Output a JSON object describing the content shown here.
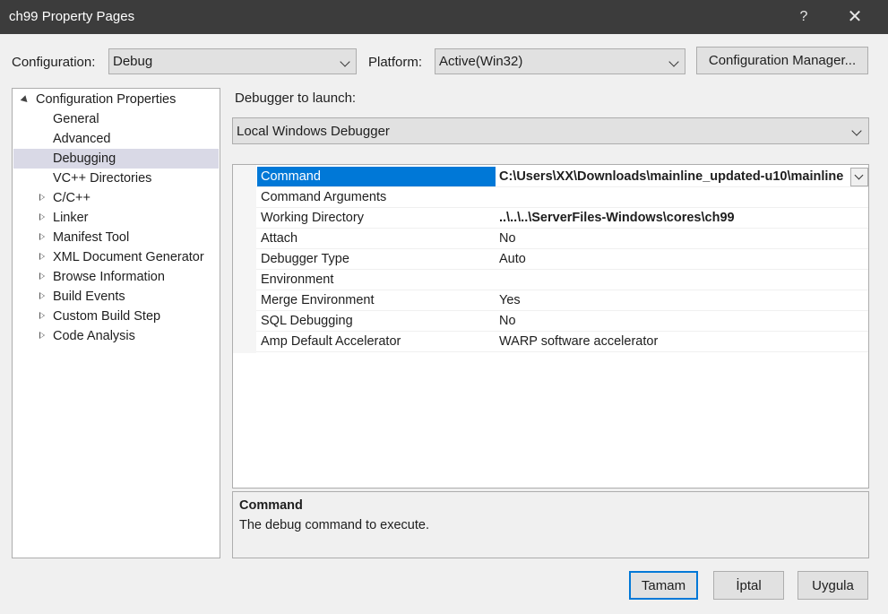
{
  "window": {
    "title": "ch99 Property Pages",
    "help_label": "?",
    "close_label": "✕"
  },
  "header": {
    "configuration_label": "Configuration:",
    "configuration_value": "Debug",
    "platform_label": "Platform:",
    "platform_value": "Active(Win32)",
    "config_manager_label": "Configuration Manager..."
  },
  "tree": {
    "root": "Configuration Properties",
    "items": [
      {
        "label": "General"
      },
      {
        "label": "Advanced"
      },
      {
        "label": "Debugging",
        "selected": true
      },
      {
        "label": "VC++ Directories"
      },
      {
        "label": "C/C++",
        "expandable": true
      },
      {
        "label": "Linker",
        "expandable": true
      },
      {
        "label": "Manifest Tool",
        "expandable": true
      },
      {
        "label": "XML Document Generator",
        "expandable": true
      },
      {
        "label": "Browse Information",
        "expandable": true
      },
      {
        "label": "Build Events",
        "expandable": true
      },
      {
        "label": "Custom Build Step",
        "expandable": true
      },
      {
        "label": "Code Analysis",
        "expandable": true
      }
    ]
  },
  "debugger": {
    "label": "Debugger to launch:",
    "value": "Local Windows Debugger"
  },
  "properties": [
    {
      "name": "Command",
      "value": "C:\\Users\\XX\\Downloads\\mainline_updated-u10\\mainline",
      "bold": true,
      "selected": true
    },
    {
      "name": "Command Arguments",
      "value": ""
    },
    {
      "name": "Working Directory",
      "value": "..\\..\\..\\ServerFiles-Windows\\cores\\ch99",
      "bold": true
    },
    {
      "name": "Attach",
      "value": "No"
    },
    {
      "name": "Debugger Type",
      "value": "Auto"
    },
    {
      "name": "Environment",
      "value": ""
    },
    {
      "name": "Merge Environment",
      "value": "Yes"
    },
    {
      "name": "SQL Debugging",
      "value": "No"
    },
    {
      "name": "Amp Default Accelerator",
      "value": "WARP software accelerator"
    }
  ],
  "description": {
    "title": "Command",
    "text": "The debug command to execute."
  },
  "buttons": {
    "ok": "Tamam",
    "cancel": "İptal",
    "apply": "Uygula"
  }
}
